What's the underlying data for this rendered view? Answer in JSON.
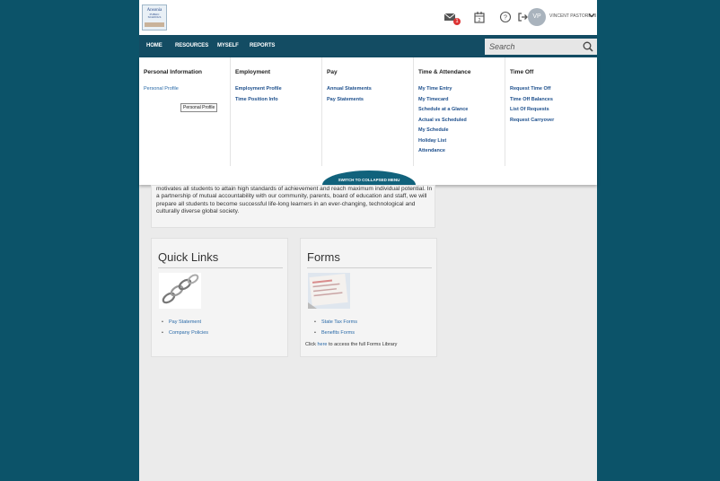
{
  "header": {
    "logo_text": "Ansonia",
    "logo_subtext": "PUBLIC SCHOOLS",
    "mail_badge": "1",
    "calendar_day": "2",
    "avatar_initials": "VP",
    "user_name": "VINCENT PASTORE III"
  },
  "nav": {
    "items": [
      "HOME",
      "RESOURCES",
      "MYSELF",
      "REPORTS"
    ],
    "search_placeholder": "Search"
  },
  "mega_menu": {
    "columns": [
      {
        "heading": "Personal Information",
        "links": [
          "Personal Profile"
        ]
      },
      {
        "heading": "Employment",
        "links": [
          "Employment Profile",
          "Time Position Info"
        ]
      },
      {
        "heading": "Pay",
        "links": [
          "Annual Statements",
          "Pay Statements"
        ]
      },
      {
        "heading": "Time & Attendance",
        "links": [
          "My Time Entry",
          "My Timecard",
          "Schedule at a Glance",
          "Actual vs Scheduled",
          "My Schedule",
          "Holiday List",
          "Attendance"
        ]
      },
      {
        "heading": "Time Off",
        "links": [
          "Request Time Off",
          "Time Off Balances",
          "List Of Requests",
          "Request Carryover"
        ]
      }
    ],
    "tooltip": "Personal Profile",
    "collapse_label": "SWITCH TO COLLAPSED MENU"
  },
  "mission": {
    "text": "motivates all students to attain high standards of achievement and reach maximum individual potential. In a partnership of mutual accountability with our community, parents, board of education and staff, we will prepare all students to become successful life-long learners in an ever-changing, technological and culturally diverse global society."
  },
  "quick_links": {
    "title": "Quick Links",
    "items": [
      "Pay Statement",
      "Company Policies"
    ]
  },
  "forms": {
    "title": "Forms",
    "items": [
      "State Tax Forms",
      "Benefits Forms"
    ],
    "note_prefix": "Click ",
    "note_link": "here",
    "note_suffix": " to access the full Forms Library"
  }
}
